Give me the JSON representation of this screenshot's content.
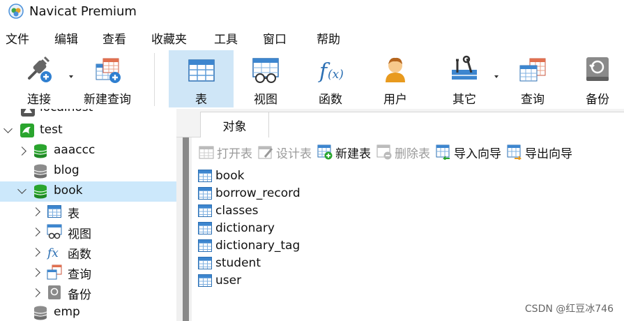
{
  "window": {
    "title": "Navicat Premium"
  },
  "menu": [
    "文件",
    "编辑",
    "查看",
    "收藏夹",
    "工具",
    "窗口",
    "帮助"
  ],
  "toolbar": [
    {
      "label": "连接",
      "icon": "plug-icon"
    },
    {
      "label": "新建查询",
      "icon": "new-query-icon"
    },
    {
      "label": "表",
      "icon": "table-icon",
      "active": true
    },
    {
      "label": "视图",
      "icon": "view-icon"
    },
    {
      "label": "函数",
      "icon": "function-icon"
    },
    {
      "label": "用户",
      "icon": "user-icon"
    },
    {
      "label": "其它",
      "icon": "tools-icon"
    },
    {
      "label": "查询",
      "icon": "query-icon"
    },
    {
      "label": "备份",
      "icon": "backup-icon"
    }
  ],
  "tree": {
    "rows": [
      {
        "label": "localhost"
      },
      {
        "label": "test"
      },
      {
        "label": "aaaccc"
      },
      {
        "label": "blog"
      },
      {
        "label": "book"
      },
      {
        "label": "表"
      },
      {
        "label": "视图"
      },
      {
        "label": "函数"
      },
      {
        "label": "查询"
      },
      {
        "label": "备份"
      },
      {
        "label": "emp"
      }
    ]
  },
  "tabs": {
    "active": "对象"
  },
  "object_toolbar": {
    "open": "打开表",
    "design": "设计表",
    "new": "新建表",
    "delete": "删除表",
    "import": "导入向导",
    "export": "导出向导"
  },
  "objects": [
    "book",
    "borrow_record",
    "classes",
    "dictionary",
    "dictionary_tag",
    "student",
    "user"
  ],
  "watermark": "CSDN @红豆冰746",
  "colors": {
    "accent": "#3d86cf",
    "selection": "#cce8fb",
    "db_green": "#2aa52e"
  }
}
